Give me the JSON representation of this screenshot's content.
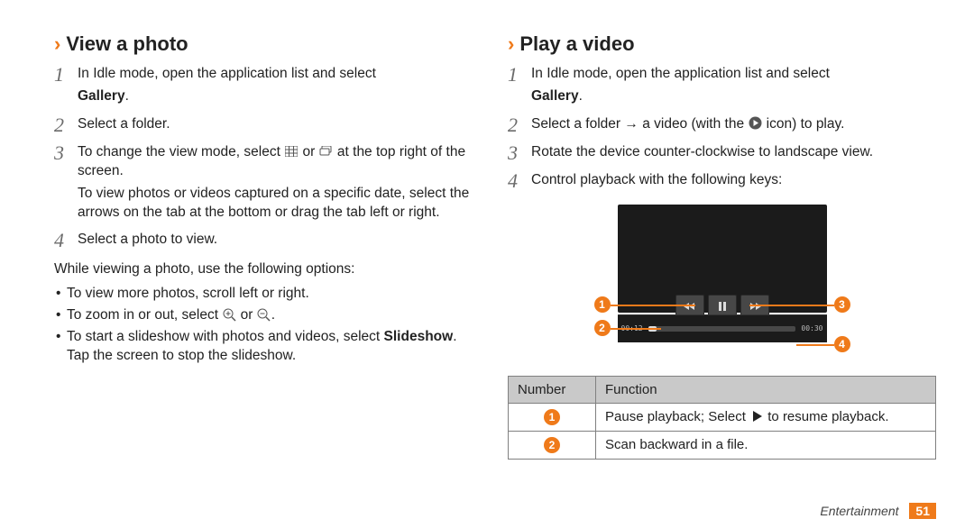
{
  "left": {
    "heading": "View a photo",
    "steps": [
      {
        "n": "1",
        "lines": [
          [
            "In Idle mode, open the application list and select "
          ],
          [
            "__BOLD__Gallery",
            "."
          ]
        ]
      },
      {
        "n": "2",
        "lines": [
          [
            "Select a folder."
          ]
        ]
      },
      {
        "n": "3",
        "lines": [
          [
            "To change the view mode, select ",
            "__ICON__grid",
            " or ",
            "__ICON__stack",
            " at the top right of the screen."
          ],
          [
            "To view photos or videos captured on a specific date, select the arrows on the tab at the bottom or drag the tab left or right."
          ]
        ]
      },
      {
        "n": "4",
        "lines": [
          [
            "Select a photo to view."
          ]
        ]
      }
    ],
    "after_steps": "While viewing a photo, use the following options:",
    "bullets": [
      [
        [
          "To view more photos, scroll left or right."
        ]
      ],
      [
        [
          "To zoom in or out, select ",
          "__ICON__zoom-in",
          " or ",
          "__ICON__zoom-out",
          "."
        ]
      ],
      [
        [
          "To start a slideshow with photos and videos, select ",
          "__BOLD__Slideshow",
          ". Tap the screen to stop the slideshow."
        ]
      ]
    ]
  },
  "right": {
    "heading": "Play a video",
    "steps": [
      {
        "n": "1",
        "lines": [
          [
            "In Idle mode, open the application list and select "
          ],
          [
            "__BOLD__Gallery",
            "."
          ]
        ]
      },
      {
        "n": "2",
        "lines": [
          [
            "Select a folder → a video (with the ",
            "__ICON__play-disc",
            " icon) to play."
          ]
        ]
      },
      {
        "n": "3",
        "lines": [
          [
            "Rotate the device counter-clockwise to landscape view."
          ]
        ]
      },
      {
        "n": "4",
        "lines": [
          [
            "Control playback with the following keys:"
          ]
        ]
      }
    ],
    "scrub_left": "00:12",
    "scrub_right": "00:30",
    "annot": {
      "1": "1",
      "2": "2",
      "3": "3",
      "4": "4"
    },
    "table": {
      "head": [
        "Number",
        "Function"
      ],
      "rows": [
        {
          "n": "1",
          "text": [
            [
              "Pause playback; Select ",
              "__ICON__play",
              " to resume playback."
            ]
          ]
        },
        {
          "n": "2",
          "text": [
            [
              "Scan backward in a file."
            ]
          ]
        }
      ]
    }
  },
  "footer": {
    "section": "Entertainment",
    "page": "51"
  }
}
